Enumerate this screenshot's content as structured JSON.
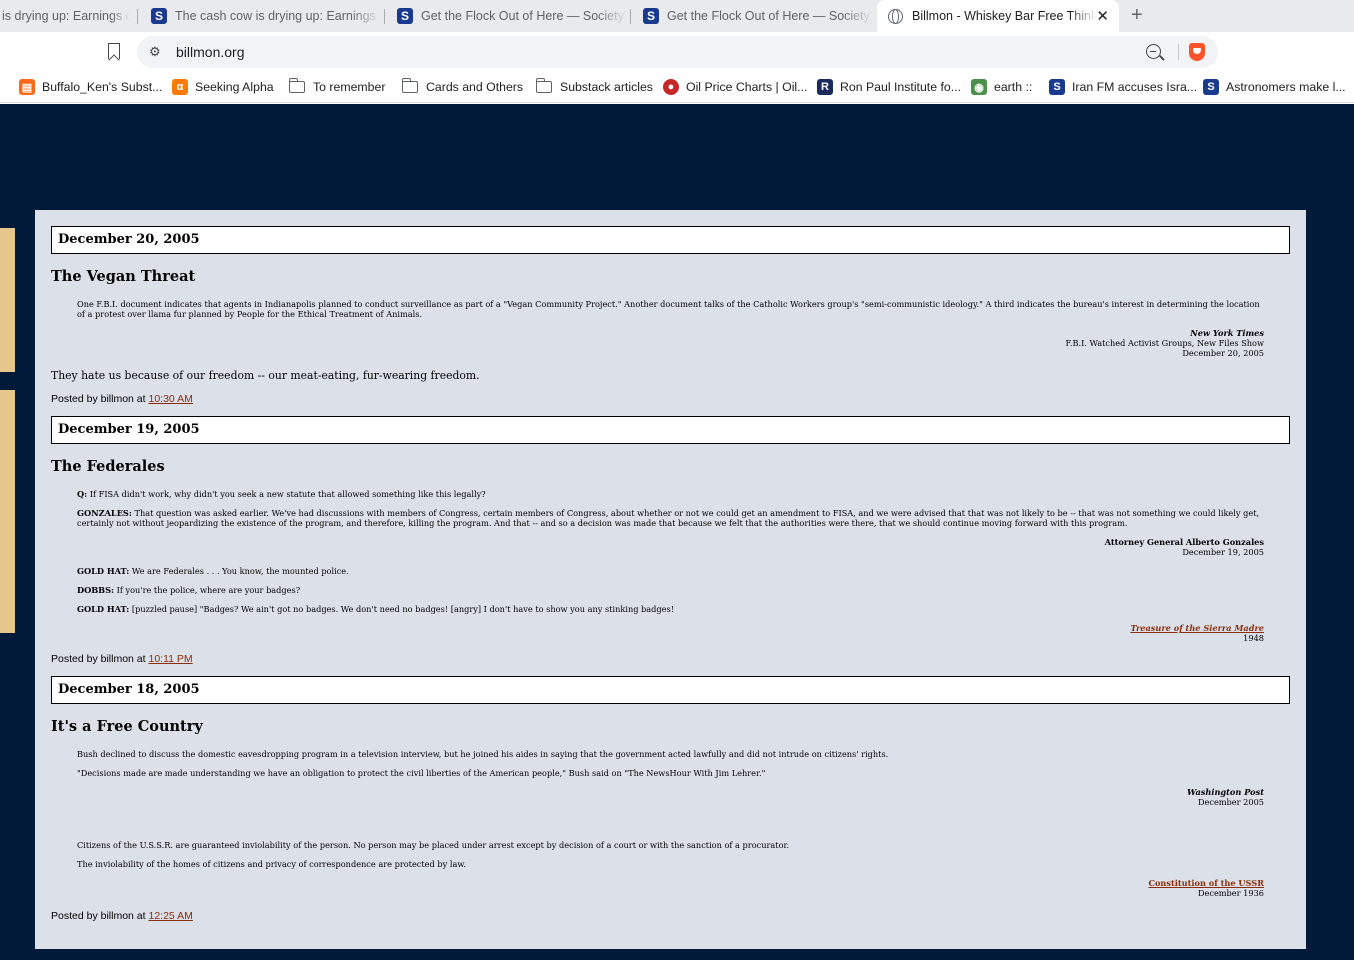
{
  "browser": {
    "tabs": [
      {
        "title": "is drying up: Earnings c",
        "icon": "none",
        "active": false
      },
      {
        "title": "The cash cow is drying up: Earnings c",
        "icon": "S",
        "active": false
      },
      {
        "title": "Get the Flock Out of Here — Society's",
        "icon": "S",
        "active": false
      },
      {
        "title": "Get the Flock Out of Here — Society's",
        "icon": "S",
        "active": false
      },
      {
        "title": "Billmon - Whiskey Bar Free Think",
        "icon": "globe",
        "active": true
      }
    ],
    "new_tab": "+",
    "close_glyph": "✕",
    "url": "billmon.org",
    "bookmarks": [
      {
        "label": "Buffalo_Ken's Subst...",
        "icon": "substack-icon"
      },
      {
        "label": "Seeking Alpha",
        "icon": "seeking-alpha-icon"
      },
      {
        "label": "To remember",
        "icon": "folder-icon"
      },
      {
        "label": "Cards and Others",
        "icon": "folder-icon"
      },
      {
        "label": "Substack articles",
        "icon": "folder-icon"
      },
      {
        "label": "Oil Price Charts | Oil...",
        "icon": "oil-price-icon"
      },
      {
        "label": "Ron Paul Institute fo...",
        "icon": "ron-paul-icon"
      },
      {
        "label": "earth ::",
        "icon": "earth-icon"
      },
      {
        "label": "Iran FM accuses Isra...",
        "icon": "S"
      },
      {
        "label": "Astronomers make l...",
        "icon": "S"
      }
    ],
    "colors": {
      "tabbar": "#e8eaed",
      "page_bg": "#011a3a",
      "content_bg": "#dce1e9",
      "link": "#8b2d0a",
      "sidebar_tab": "#e6c68a"
    }
  },
  "posts": [
    {
      "date": "December 20, 2005",
      "title": "The Vegan Threat",
      "quote": "One F.B.I. document indicates that agents in Indianapolis planned to conduct surveillance as part of a \"Vegan Community Project.\" Another document talks of the Catholic Workers group's \"semi-communistic ideology.\" A third indicates the bureau's interest in determining the location of a protest over llama fur planned by People for the Ethical Treatment of Animals.",
      "cite_source": "New York Times",
      "cite_line2": "F.B.I. Watched Activist Groups, New Files Show",
      "cite_date": "December 20, 2005",
      "comment": "They hate us because of our freedom -- our meat-eating, fur-wearing freedom.",
      "posted_prefix": "Posted by billmon at",
      "time": "10:30 AM"
    },
    {
      "date": "December 19, 2005",
      "title": "The Federales",
      "q_label": "Q:",
      "q_text": "If FISA didn't work, why didn't you seek a new statute that allowed something like this legally?",
      "g_label": "GONZALES:",
      "g_text": "That question was asked earlier. We've had discussions with members of Congress, certain members of Congress, about whether or not we could get an amendment to FISA, and we were advised that that was not likely to be -- that was not something we could likely get, certainly not without jeopardizing the existence of the program, and therefore, killing the program. And that -- and so a decision was made that because we felt that the authorities were there, that we should continue moving forward with this program.",
      "cite1_source": "Attorney General Alberto Gonzales",
      "cite1_date": "December 19, 2005",
      "gh1_label": "GOLD HAT:",
      "gh1_text": "We are Federales . . . You know, the mounted police.",
      "dobbs_label": "DOBBS:",
      "dobbs_text": "If you're the police, where are your badges?",
      "gh2_label": "GOLD HAT:",
      "gh2_text": "[puzzled pause] \"Badges? We ain't got no badges. We don't need no badges! [angry] I don't have to show you any stinking badges!",
      "cite2_link": "Treasure of the Sierra Madre",
      "cite2_year": "1948",
      "posted_prefix": "Posted by billmon at",
      "time": "10:11 PM"
    },
    {
      "date": "December 18, 2005",
      "title": "It's a Free Country",
      "quote1": "Bush declined to discuss the domestic eavesdropping program in a television interview, but he joined his aides in saying that the government acted lawfully and did not intrude on citizens' rights.",
      "quote2": "\"Decisions made are made understanding we have an obligation to protect the civil liberties of the American people,\" Bush said on \"The NewsHour With Jim Lehrer.\"",
      "cite1_source": "Washington Post",
      "cite1_date": "December 2005",
      "quote3": "Citizens of the U.S.S.R. are guaranteed inviolability of the person. No person may be placed under arrest except by decision of a court or with the sanction of a procurator.",
      "quote4": "The inviolability of the homes of citizens and privacy of correspondence are protected by law.",
      "cite2_link": "Constitution of the USSR",
      "cite2_date": "December 1936",
      "posted_prefix": "Posted by billmon at",
      "time": "12:25 AM"
    }
  ]
}
